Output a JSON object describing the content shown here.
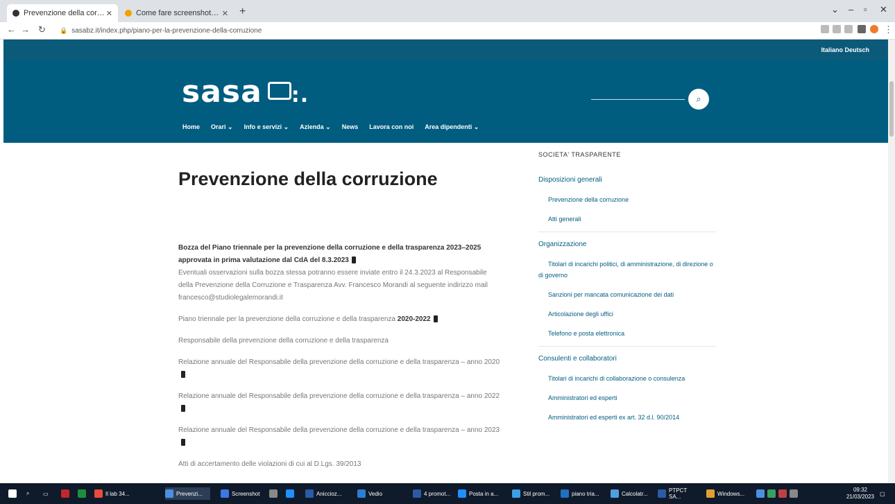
{
  "browser": {
    "tabs": [
      {
        "label": "Prevenzione della corruzione - ...",
        "favicon_color": "#333333"
      },
      {
        "label": "Come fare screenshot PC | Salvat...",
        "favicon_color": "#f4a000"
      }
    ],
    "url": "sasabz.it/index.php/piano-per-la-prevenzione-della-corruzione"
  },
  "site": {
    "lang": "Italiano Deutsch",
    "logo": "sasa",
    "nav": [
      "Home",
      "Orari ⌄",
      "Info e servizi ⌄",
      "Azienda ⌄",
      "News",
      "Lavora con noi",
      "Area dipendenti ⌄"
    ]
  },
  "page": {
    "title": "Prevenzione della corruzione",
    "p1_title": "Bozza del Piano triennale per la prevenzione della corruzione e della trasparenza 2023–2025 approvata in prima valutazione dal CdA del 8.3.2023",
    "p1_body": "Eventuali osservazioni sulla bozza stessa potranno essere inviate entro il 24.3.2023 al Responsabile della Prevenzione della Corruzione e Trasparenza Avv. Francesco Morandi al seguente indirizzo mail",
    "p1_email": "francesco@studiolegalemorandi.it",
    "p2": "Piano triennale per la prevenzione della corruzione e della trasparenza",
    "p2_bold": "2020-2022",
    "p3": "Responsabile della prevenzione della corruzione e della trasparenza",
    "p4": "Relazione annuale del Responsabile della prevenzione della corruzione e della trasparenza – anno 2020",
    "p5": "Relazione annuale del Responsabile della prevenzione della corruzione e della trasparenza – anno 2022",
    "p6": "Relazione annuale del Responsabile della prevenzione della corruzione e della trasparenza – anno 2023",
    "p7": "Atti di accertamento delle violazioni di cui al D.Lgs. 39/2013"
  },
  "sidebar": {
    "title": "SOCIETA' TRASPARENTE",
    "sec1": "Disposizioni generali",
    "sec1_items": [
      "Prevenzione della corruzione",
      "Atti generali"
    ],
    "sec2": "Organizzazione",
    "sec2_items": [
      "Titolari di incarichi politici, di amministrazione, di direzione o di governo",
      "Sanzioni per mancata comunicazione dei dati",
      "Articolazione degli uffici",
      "Telefono e posta elettronica"
    ],
    "sec3": "Consulenti e collaboratori",
    "sec3_items": [
      "Titolari di incarichi di collaborazione o consulenza",
      "Amministratori ed esperti",
      "Amministratori ed esperti ex art. 32 d.l. 90/2014"
    ]
  },
  "taskbar": {
    "items": [
      "Il lab 34...",
      "Prevenzi...",
      "Screenshot",
      "Aniccioz...",
      "Vedio",
      "4 promot...",
      "Posta in a...",
      "Stil prom...",
      "piano tria...",
      "Calcolatr...",
      "PTPCT SA...",
      "Windows..."
    ],
    "time": "09:32",
    "date": "21/03/2023"
  },
  "colors": {
    "header": "#005d7f",
    "topbar": "#0c5a7a"
  }
}
